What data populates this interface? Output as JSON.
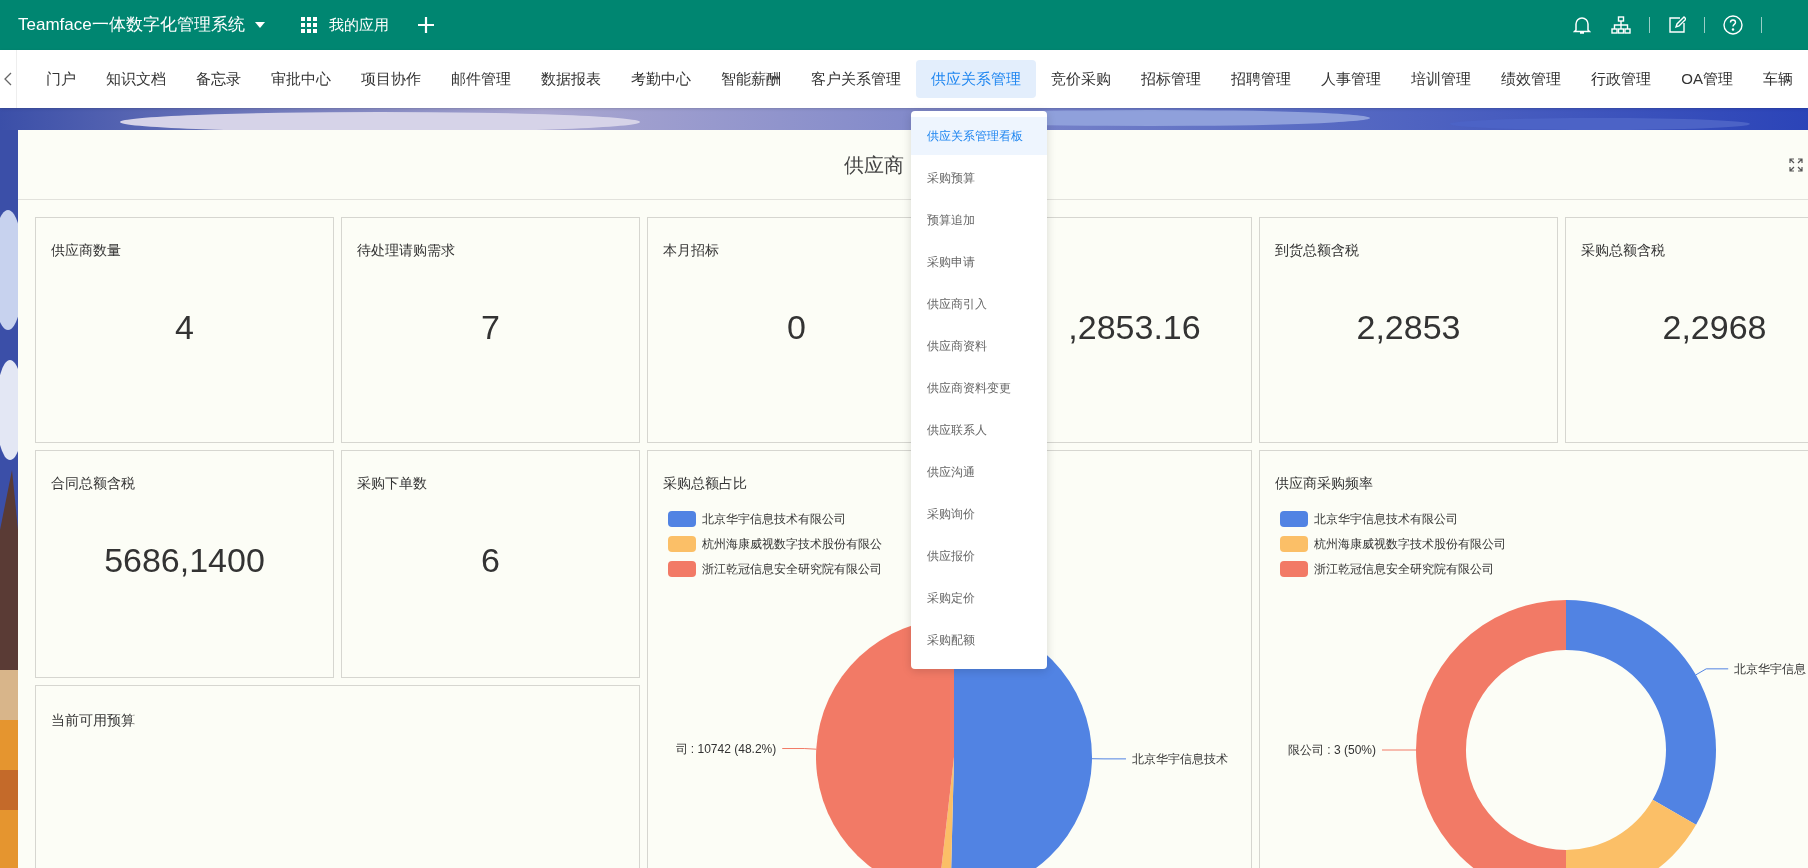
{
  "topbar": {
    "title": "Teamface一体数字化管理系统",
    "apps_label": "我的应用"
  },
  "nav": {
    "items": [
      {
        "label": "门户",
        "selected": false
      },
      {
        "label": "知识文档",
        "selected": false
      },
      {
        "label": "备忘录",
        "selected": false
      },
      {
        "label": "审批中心",
        "selected": false
      },
      {
        "label": "项目协作",
        "selected": false
      },
      {
        "label": "邮件管理",
        "selected": false
      },
      {
        "label": "数据报表",
        "selected": false
      },
      {
        "label": "考勤中心",
        "selected": false
      },
      {
        "label": "智能薪酬",
        "selected": false
      },
      {
        "label": "客户关系管理",
        "selected": false
      },
      {
        "label": "供应关系管理",
        "selected": true
      },
      {
        "label": "竞价采购",
        "selected": false
      },
      {
        "label": "招标管理",
        "selected": false
      },
      {
        "label": "招聘管理",
        "selected": false
      },
      {
        "label": "人事管理",
        "selected": false
      },
      {
        "label": "培训管理",
        "selected": false
      },
      {
        "label": "绩效管理",
        "selected": false
      },
      {
        "label": "行政管理",
        "selected": false
      },
      {
        "label": "OA管理",
        "selected": false
      },
      {
        "label": "车辆",
        "selected": false
      }
    ]
  },
  "dropdown": {
    "items": [
      {
        "label": "供应关系管理看板",
        "selected": true
      },
      {
        "label": "采购预算",
        "selected": false
      },
      {
        "label": "预算追加",
        "selected": false
      },
      {
        "label": "采购申请",
        "selected": false
      },
      {
        "label": "供应商引入",
        "selected": false
      },
      {
        "label": "供应商资料",
        "selected": false
      },
      {
        "label": "供应商资料变更",
        "selected": false
      },
      {
        "label": "供应联系人",
        "selected": false
      },
      {
        "label": "供应沟通",
        "selected": false
      },
      {
        "label": "采购询价",
        "selected": false
      },
      {
        "label": "供应报价",
        "selected": false
      },
      {
        "label": "采购定价",
        "selected": false
      },
      {
        "label": "采购配额",
        "selected": false
      }
    ]
  },
  "dashboard": {
    "title": "供应商",
    "stat_cards": [
      {
        "label": "供应商数量",
        "value": "4"
      },
      {
        "label": "待处理请购需求",
        "value": "7"
      },
      {
        "label": "本月招标",
        "value": "0"
      },
      {
        "value": ",2853.16"
      },
      {
        "label": "到货总额含税",
        "value": "2,2853"
      },
      {
        "label": "采购总额含税",
        "value": "2,2968"
      },
      {
        "label": "合同总额含税",
        "value": "5686,1400"
      },
      {
        "label": "采购下单数",
        "value": "6"
      }
    ],
    "charts": [
      {
        "chart_data": {
          "type": "pie",
          "title": "采购总额占比",
          "legend": "top",
          "categories": [
            "北京华宇信息技术有限公司",
            "杭州海康威视数字技术股份有限公",
            "浙江乾冠信息安全研究院有限公司"
          ],
          "colors": [
            "#5183e3",
            "#fbbf67",
            "#f27a66"
          ],
          "series": [
            {
              "values": [
                50.4,
                1.4,
                48.2
              ]
            }
          ],
          "value_labels": [
            "北京华宇信息技术",
            null,
            "司 : 10742 (48.2%)"
          ]
        }
      },
      {
        "chart_data": {
          "type": "donut",
          "title": "供应商采购频率",
          "legend": "top",
          "categories": [
            "北京华宇信息技术有限公司",
            "杭州海康威视数字技术股份有限公司",
            "浙江乾冠信息安全研究院有限公司"
          ],
          "colors": [
            "#5183e3",
            "#fbbf67",
            "#f27a66"
          ],
          "series": [
            {
              "values": [
                33.3,
                16.7,
                50
              ]
            }
          ],
          "value_labels": [
            "北京华宇信息",
            null,
            "限公司 : 3 (50%)"
          ]
        }
      }
    ],
    "budget_card": {
      "label": "当前可用预算"
    }
  }
}
